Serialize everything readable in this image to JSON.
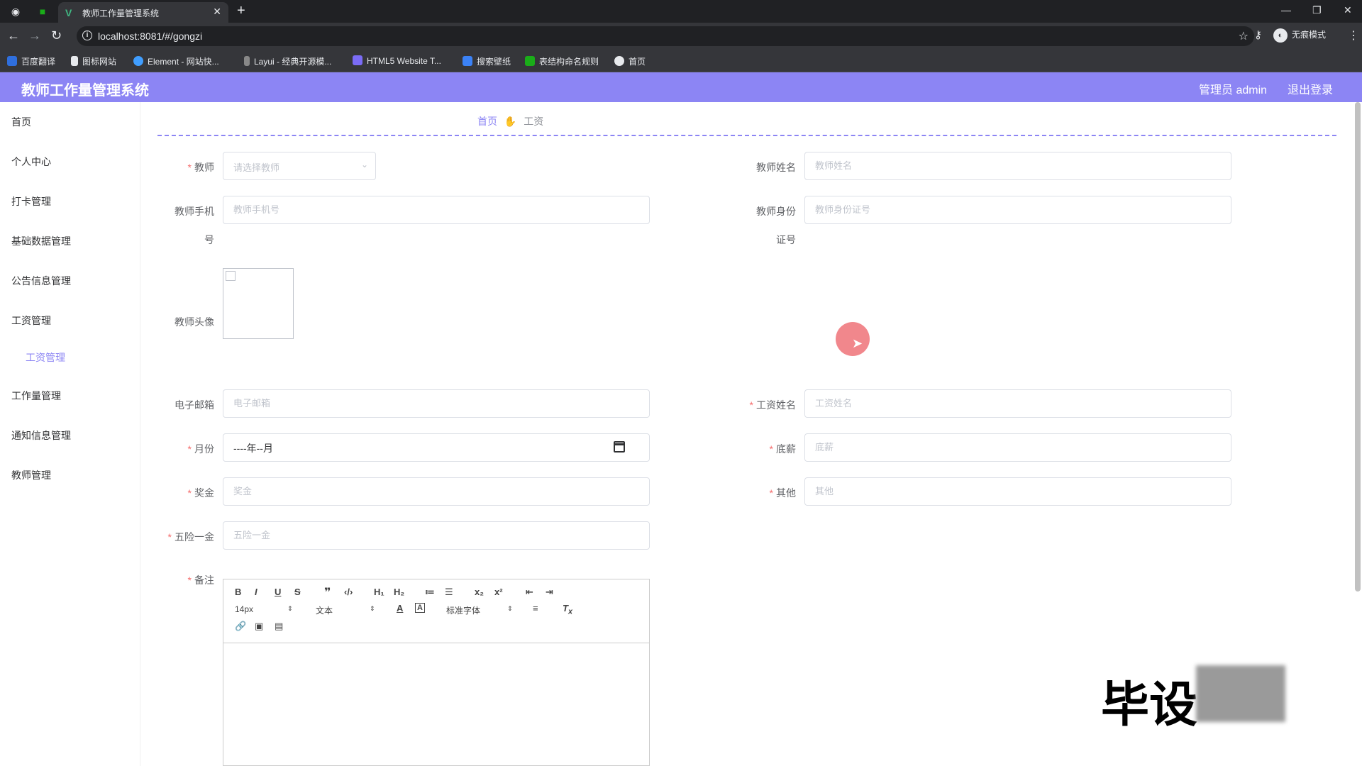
{
  "browser": {
    "tab_title": "教师工作量管理系统",
    "url": "localhost:8081/#/gongzi",
    "profile_label": "无痕模式",
    "bookmarks": [
      "百度翻译",
      "图标网站",
      "Element - 网站快...",
      "Layui - 经典开源模...",
      "HTML5 Website T...",
      "搜索壁纸",
      "表结构命名规则",
      "首页"
    ]
  },
  "header": {
    "title": "教师工作量管理系统",
    "admin": "管理员 admin",
    "logout": "退出登录"
  },
  "sidebar": {
    "items": [
      "首页",
      "个人中心",
      "打卡管理",
      "基础数据管理",
      "公告信息管理",
      "工资管理",
      "工作量管理",
      "通知信息管理",
      "教师管理"
    ],
    "active_sub": "工资管理"
  },
  "breadcrumb": {
    "home": "首页",
    "current": "工资"
  },
  "form": {
    "teacher": {
      "label": "教师",
      "placeholder": "请选择教师"
    },
    "teacher_name": {
      "label": "教师姓名",
      "placeholder": "教师姓名"
    },
    "teacher_phone": {
      "label_a": "教师手机",
      "label_b": "号",
      "placeholder": "教师手机号"
    },
    "teacher_id": {
      "label_a": "教师身份",
      "label_b": "证号",
      "placeholder": "教师身份证号"
    },
    "avatar": {
      "label": "教师头像"
    },
    "email": {
      "label": "电子邮箱",
      "placeholder": "电子邮箱"
    },
    "salary_name": {
      "label": "工资姓名",
      "placeholder": "工资姓名"
    },
    "month": {
      "label": "月份",
      "value": "----年--月"
    },
    "base_salary": {
      "label": "底薪",
      "placeholder": "底薪"
    },
    "bonus": {
      "label": "奖金",
      "placeholder": "奖金"
    },
    "other": {
      "label": "其他",
      "placeholder": "其他"
    },
    "insurance": {
      "label": "五险一金",
      "placeholder": "五险一金"
    },
    "remark": {
      "label": "备注"
    }
  },
  "editor": {
    "font_size": "14px",
    "header_select": "文本",
    "font_family": "标准字体"
  },
  "watermark": "毕设",
  "colors": {
    "accent": "#8c85f4",
    "required": "#f56c6c"
  }
}
